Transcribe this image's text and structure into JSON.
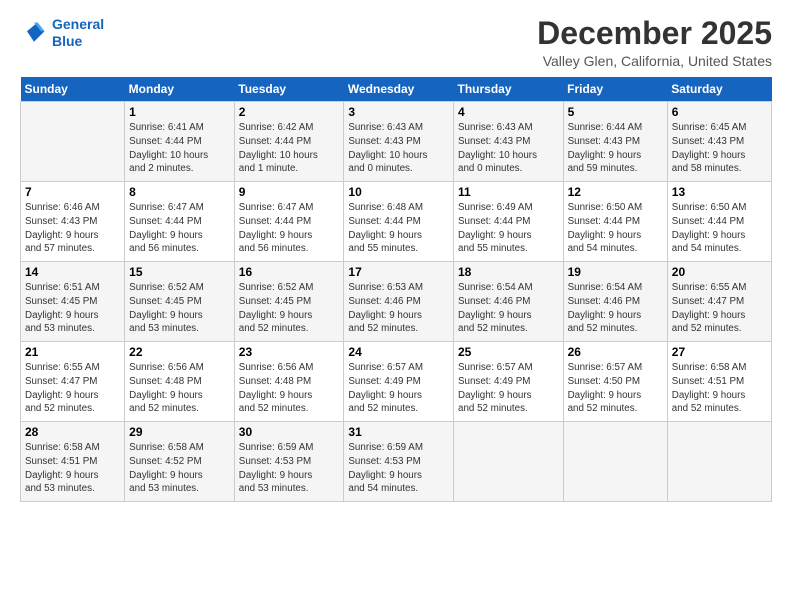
{
  "logo": {
    "line1": "General",
    "line2": "Blue"
  },
  "title": "December 2025",
  "subtitle": "Valley Glen, California, United States",
  "header_days": [
    "Sunday",
    "Monday",
    "Tuesday",
    "Wednesday",
    "Thursday",
    "Friday",
    "Saturday"
  ],
  "weeks": [
    [
      {
        "num": "",
        "info": ""
      },
      {
        "num": "1",
        "info": "Sunrise: 6:41 AM\nSunset: 4:44 PM\nDaylight: 10 hours\nand 2 minutes."
      },
      {
        "num": "2",
        "info": "Sunrise: 6:42 AM\nSunset: 4:44 PM\nDaylight: 10 hours\nand 1 minute."
      },
      {
        "num": "3",
        "info": "Sunrise: 6:43 AM\nSunset: 4:43 PM\nDaylight: 10 hours\nand 0 minutes."
      },
      {
        "num": "4",
        "info": "Sunrise: 6:43 AM\nSunset: 4:43 PM\nDaylight: 10 hours\nand 0 minutes."
      },
      {
        "num": "5",
        "info": "Sunrise: 6:44 AM\nSunset: 4:43 PM\nDaylight: 9 hours\nand 59 minutes."
      },
      {
        "num": "6",
        "info": "Sunrise: 6:45 AM\nSunset: 4:43 PM\nDaylight: 9 hours\nand 58 minutes."
      }
    ],
    [
      {
        "num": "7",
        "info": "Sunrise: 6:46 AM\nSunset: 4:43 PM\nDaylight: 9 hours\nand 57 minutes."
      },
      {
        "num": "8",
        "info": "Sunrise: 6:47 AM\nSunset: 4:44 PM\nDaylight: 9 hours\nand 56 minutes."
      },
      {
        "num": "9",
        "info": "Sunrise: 6:47 AM\nSunset: 4:44 PM\nDaylight: 9 hours\nand 56 minutes."
      },
      {
        "num": "10",
        "info": "Sunrise: 6:48 AM\nSunset: 4:44 PM\nDaylight: 9 hours\nand 55 minutes."
      },
      {
        "num": "11",
        "info": "Sunrise: 6:49 AM\nSunset: 4:44 PM\nDaylight: 9 hours\nand 55 minutes."
      },
      {
        "num": "12",
        "info": "Sunrise: 6:50 AM\nSunset: 4:44 PM\nDaylight: 9 hours\nand 54 minutes."
      },
      {
        "num": "13",
        "info": "Sunrise: 6:50 AM\nSunset: 4:44 PM\nDaylight: 9 hours\nand 54 minutes."
      }
    ],
    [
      {
        "num": "14",
        "info": "Sunrise: 6:51 AM\nSunset: 4:45 PM\nDaylight: 9 hours\nand 53 minutes."
      },
      {
        "num": "15",
        "info": "Sunrise: 6:52 AM\nSunset: 4:45 PM\nDaylight: 9 hours\nand 53 minutes."
      },
      {
        "num": "16",
        "info": "Sunrise: 6:52 AM\nSunset: 4:45 PM\nDaylight: 9 hours\nand 52 minutes."
      },
      {
        "num": "17",
        "info": "Sunrise: 6:53 AM\nSunset: 4:46 PM\nDaylight: 9 hours\nand 52 minutes."
      },
      {
        "num": "18",
        "info": "Sunrise: 6:54 AM\nSunset: 4:46 PM\nDaylight: 9 hours\nand 52 minutes."
      },
      {
        "num": "19",
        "info": "Sunrise: 6:54 AM\nSunset: 4:46 PM\nDaylight: 9 hours\nand 52 minutes."
      },
      {
        "num": "20",
        "info": "Sunrise: 6:55 AM\nSunset: 4:47 PM\nDaylight: 9 hours\nand 52 minutes."
      }
    ],
    [
      {
        "num": "21",
        "info": "Sunrise: 6:55 AM\nSunset: 4:47 PM\nDaylight: 9 hours\nand 52 minutes."
      },
      {
        "num": "22",
        "info": "Sunrise: 6:56 AM\nSunset: 4:48 PM\nDaylight: 9 hours\nand 52 minutes."
      },
      {
        "num": "23",
        "info": "Sunrise: 6:56 AM\nSunset: 4:48 PM\nDaylight: 9 hours\nand 52 minutes."
      },
      {
        "num": "24",
        "info": "Sunrise: 6:57 AM\nSunset: 4:49 PM\nDaylight: 9 hours\nand 52 minutes."
      },
      {
        "num": "25",
        "info": "Sunrise: 6:57 AM\nSunset: 4:49 PM\nDaylight: 9 hours\nand 52 minutes."
      },
      {
        "num": "26",
        "info": "Sunrise: 6:57 AM\nSunset: 4:50 PM\nDaylight: 9 hours\nand 52 minutes."
      },
      {
        "num": "27",
        "info": "Sunrise: 6:58 AM\nSunset: 4:51 PM\nDaylight: 9 hours\nand 52 minutes."
      }
    ],
    [
      {
        "num": "28",
        "info": "Sunrise: 6:58 AM\nSunset: 4:51 PM\nDaylight: 9 hours\nand 53 minutes."
      },
      {
        "num": "29",
        "info": "Sunrise: 6:58 AM\nSunset: 4:52 PM\nDaylight: 9 hours\nand 53 minutes."
      },
      {
        "num": "30",
        "info": "Sunrise: 6:59 AM\nSunset: 4:53 PM\nDaylight: 9 hours\nand 53 minutes."
      },
      {
        "num": "31",
        "info": "Sunrise: 6:59 AM\nSunset: 4:53 PM\nDaylight: 9 hours\nand 54 minutes."
      },
      {
        "num": "",
        "info": ""
      },
      {
        "num": "",
        "info": ""
      },
      {
        "num": "",
        "info": ""
      }
    ]
  ]
}
